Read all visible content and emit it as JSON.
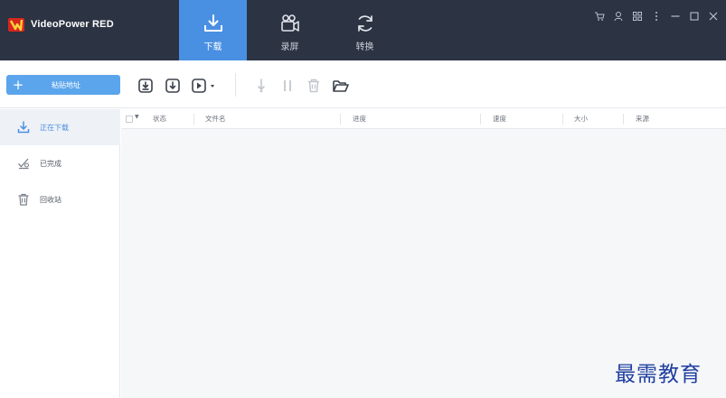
{
  "app": {
    "title": "VideoPower RED"
  },
  "main_tabs": [
    {
      "label": "下载",
      "icon": "download-tray-icon",
      "active": true
    },
    {
      "label": "录屏",
      "icon": "video-camera-icon",
      "active": false
    },
    {
      "label": "转换",
      "icon": "convert-cycle-icon",
      "active": false
    }
  ],
  "window_controls": [
    "cart-icon",
    "user-icon",
    "grid-icon",
    "more-icon",
    "minimize-icon",
    "maximize-icon",
    "close-icon"
  ],
  "toolbar": {
    "paste_label": "粘贴地址",
    "paste_icon": "plus-icon",
    "icons": [
      "download-add-icon",
      "download-icon",
      "play-dropdown-icon",
      "drop-icon",
      "pause-icon",
      "delete-icon",
      "open-folder-icon"
    ]
  },
  "sidebar": {
    "items": [
      {
        "label": "正在下载",
        "icon": "downloading-icon",
        "active": true
      },
      {
        "label": "已完成",
        "icon": "completed-icon",
        "active": false
      },
      {
        "label": "回收站",
        "icon": "trash-icon",
        "active": false
      }
    ]
  },
  "table": {
    "columns": [
      "状态",
      "文件名",
      "进度",
      "速度",
      "大小",
      "来源"
    ]
  },
  "watermark": "最需教育",
  "colors": {
    "header_bg": "#2c3342",
    "accent": "#4a90e2",
    "paste_button": "#5ba5ec",
    "sidebar_active_bg": "#eef1f6",
    "content_bg": "#f6f7f9",
    "watermark": "#1f3fa0"
  }
}
